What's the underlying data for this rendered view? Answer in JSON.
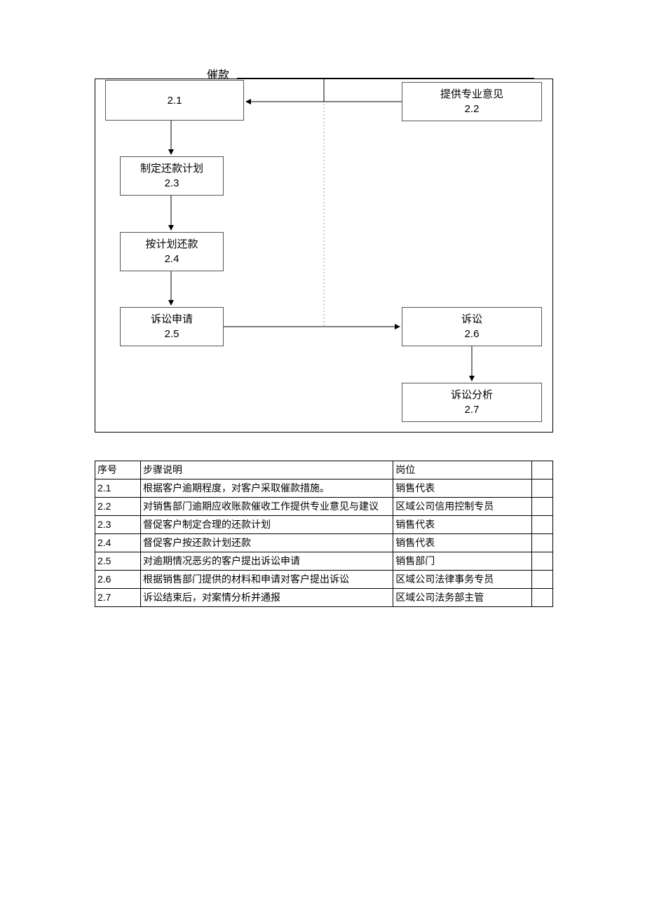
{
  "title": "催款",
  "flowchart": {
    "nodes": {
      "n21": {
        "label": "",
        "num": "2.1"
      },
      "n22": {
        "label": "提供专业意见",
        "num": "2.2"
      },
      "n23": {
        "label": "制定还款计划",
        "num": "2.3"
      },
      "n24": {
        "label": "按计划还款",
        "num": "2.4"
      },
      "n25": {
        "label": "诉讼申请",
        "num": "2.5"
      },
      "n26": {
        "label": "诉讼",
        "num": "2.6"
      },
      "n27": {
        "label": "诉讼分析",
        "num": "2.7"
      }
    }
  },
  "table": {
    "headers": {
      "seq": "序号",
      "desc": "步骤说明",
      "role": "岗位"
    },
    "rows": [
      {
        "seq": "2.1",
        "desc": "根据客户逾期程度，对客户采取催款措施。",
        "role": "销售代表"
      },
      {
        "seq": "2.2",
        "desc": "对销售部门逾期应收账款催收工作提供专业意见与建议",
        "role": "区域公司信用控制专员"
      },
      {
        "seq": "2.3",
        "desc": "督促客户制定合理的还款计划",
        "role": "销售代表"
      },
      {
        "seq": "2.4",
        "desc": "督促客户按还款计划还款",
        "role": "销售代表"
      },
      {
        "seq": "2.5",
        "desc": "对逾期情况恶劣的客户提出诉讼申请",
        "role": "销售部门"
      },
      {
        "seq": "2.6",
        "desc": "根据销售部门提供的材料和申请对客户提出诉讼",
        "role": "区域公司法律事务专员"
      },
      {
        "seq": "2.7",
        "desc": "诉讼结束后，对案情分析并通报",
        "role": "区域公司法务部主管"
      }
    ]
  }
}
